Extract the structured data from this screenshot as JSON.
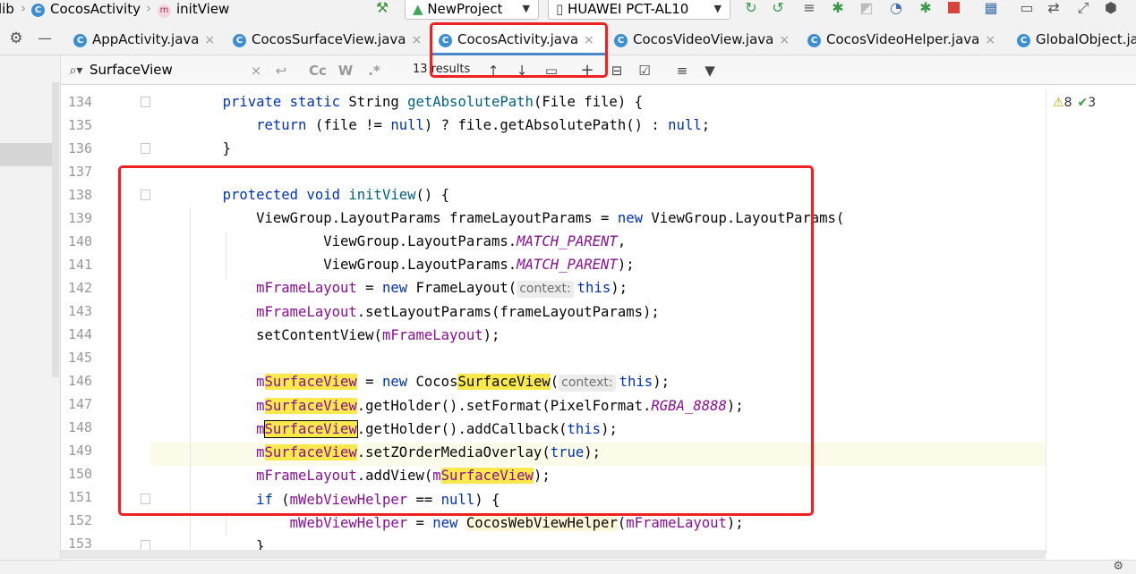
{
  "breadcrumb": {
    "root": "lib",
    "class_badge": "C",
    "class_name": "CocosActivity",
    "method_badge": "m",
    "method_name": "initView"
  },
  "toolbar": {
    "run_config": "NewProject",
    "device": "HUAWEI PCT-AL10"
  },
  "tabs": [
    {
      "badge": "C",
      "label": "AppActivity.java",
      "active": false
    },
    {
      "badge": "C",
      "label": "CocosSurfaceView.java",
      "active": false
    },
    {
      "badge": "C",
      "label": "CocosActivity.java",
      "active": true
    },
    {
      "badge": "C",
      "label": "CocosVideoView.java",
      "active": false
    },
    {
      "badge": "C",
      "label": "CocosVideoHelper.java",
      "active": false
    },
    {
      "badge": "C",
      "label": "GlobalObject.ja",
      "active": false
    }
  ],
  "search": {
    "query": "SurfaceView",
    "results": "13 results",
    "match_case": "Cc",
    "words": "W",
    "regex": ".*"
  },
  "inspection": {
    "warnings": "8",
    "weak_warnings": "3"
  },
  "line_numbers": [
    "134",
    "135",
    "136",
    "137",
    "138",
    "139",
    "140",
    "141",
    "142",
    "143",
    "144",
    "145",
    "146",
    "147",
    "148",
    "149",
    "150",
    "151",
    "152",
    "153"
  ],
  "code": {
    "l134": {
      "kw": "private static",
      "t1": " String ",
      "fn": "getAbsolutePath",
      "t2": "(File file) {"
    },
    "l135": {
      "kw": "return",
      "t1": " (file != ",
      "kw2": "null",
      "t2": ") ? file.getAbsolutePath() : ",
      "kw3": "null",
      "t3": ";"
    },
    "l136": {
      "t1": "}"
    },
    "l138": {
      "kw": "protected void",
      "t1": " ",
      "fn": "initView",
      "t2": "() {"
    },
    "l139": {
      "t1": "ViewGroup.LayoutParams frameLayoutParams = ",
      "kw": "new",
      "t2": " ViewGroup.LayoutParams("
    },
    "l140": {
      "t1": "ViewGroup.LayoutParams.",
      "it": "MATCH_PARENT",
      "t2": ","
    },
    "l141": {
      "t1": "ViewGroup.LayoutParams.",
      "it": "MATCH_PARENT",
      "t2": ");"
    },
    "l142": {
      "fld": "mFrameLayout",
      "t1": " = ",
      "kw": "new",
      "t2": " FrameLayout(",
      "hint": "context:",
      "kw2": "this",
      "t3": ");"
    },
    "l143": {
      "fld": "mFrameLayout",
      "t1": ".setLayoutParams(frameLayoutParams);"
    },
    "l144": {
      "t1": "setContentView(",
      "fld": "mFrameLayout",
      "t2": ");"
    },
    "l146": {
      "m": "m",
      "hl": "SurfaceView",
      "t1": " = ",
      "kw": "new",
      "t2": " Cocos",
      "hl2": "SurfaceView",
      "t3": "(",
      "hint": "context:",
      "kw2": "this",
      "t4": ");"
    },
    "l147": {
      "m": "m",
      "hl": "SurfaceView",
      "t1": ".getHolder().setFormat(PixelFormat.",
      "it": "RGBA_8888",
      "t2": ");"
    },
    "l148": {
      "m": "m",
      "hl": "SurfaceView",
      "t1": ".getHolder().addCallback(",
      "kw": "this",
      "t2": ");"
    },
    "l149": {
      "m": "m",
      "hl": "SurfaceView",
      "t1": ".setZOrderMediaOverlay(",
      "kw": "true",
      "t2": ");"
    },
    "l150": {
      "fld": "mFrameLayout",
      "t1": ".addView(",
      "m": "m",
      "hl": "SurfaceView",
      "t2": ");"
    },
    "l151": {
      "kw": "if",
      "t1": " (",
      "fld": "mWebViewHelper",
      "t2": " == ",
      "kw2": "null",
      "t3": ") {"
    },
    "l152": {
      "fld": "mWebViewHelper",
      "t1": " = ",
      "kw": "new",
      "t2": " ",
      "cls": "CocosWebViewHelper",
      "t3": "(",
      "fld2": "mFrameLayout",
      "t4": ");"
    },
    "l153": {
      "t1": "}"
    }
  },
  "colors": {
    "keyword": "#0033b3",
    "method": "#00627a",
    "field": "#871094",
    "match_highlight": "#f9e94d",
    "annotation_red": "#ee2222",
    "active_tab_underline": "#4a88c7"
  }
}
